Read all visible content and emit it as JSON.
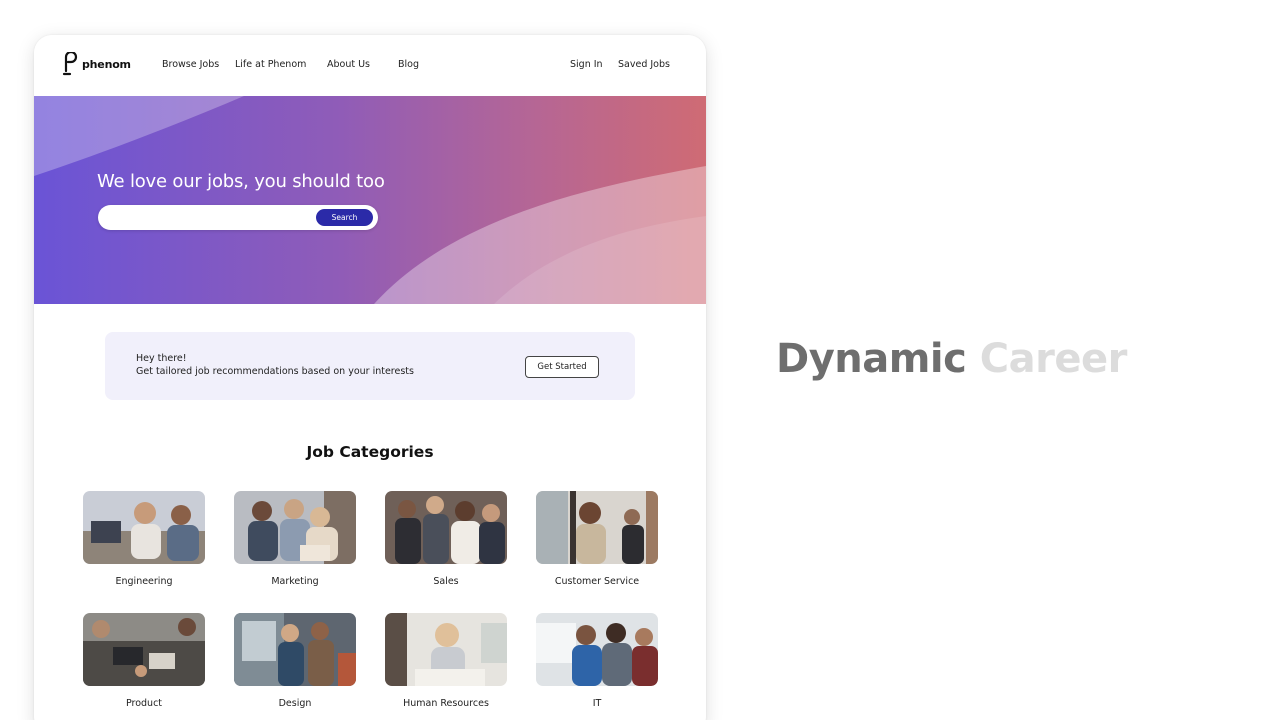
{
  "header": {
    "logo_text": "phenom",
    "nav": [
      "Browse Jobs",
      "Life at Phenom",
      "About Us",
      "Blog"
    ],
    "sign_in": "Sign In",
    "saved_jobs": "Saved Jobs"
  },
  "hero": {
    "title": "We love our jobs, you should too",
    "search_value": "",
    "search_button": "Search"
  },
  "recommendation": {
    "line1": "Hey there!",
    "line2": "Get tailored job recommendations based on your interests",
    "button": "Get Started"
  },
  "categories": {
    "title": "Job Categories",
    "items": [
      {
        "label": "Engineering"
      },
      {
        "label": "Marketing"
      },
      {
        "label": "Sales"
      },
      {
        "label": "Customer Service"
      },
      {
        "label": "Product"
      },
      {
        "label": "Design"
      },
      {
        "label": "Human Resources"
      },
      {
        "label": "IT"
      }
    ]
  },
  "tagline": {
    "word1": "Dynamic",
    "word2": "Career"
  },
  "colors": {
    "hero_start": "#6a54d6",
    "hero_end": "#cf6b74",
    "search_button": "#2b2aa8",
    "rec_card_bg": "#f1f0fb"
  }
}
